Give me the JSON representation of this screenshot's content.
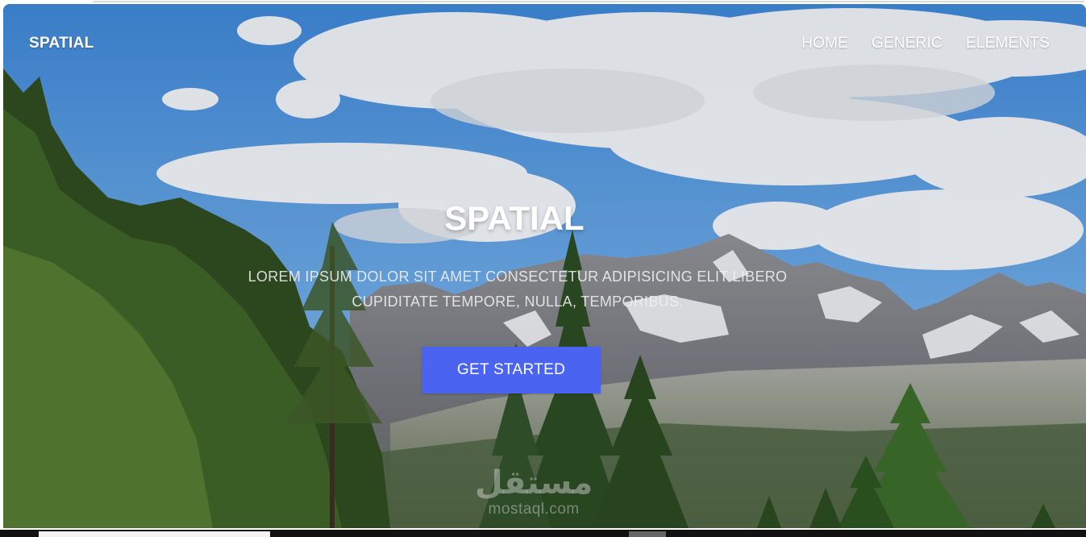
{
  "header": {
    "brand": "SPATIAL",
    "nav": [
      {
        "label": "HOME"
      },
      {
        "label": "GENERIC"
      },
      {
        "label": "ELEMENTS"
      }
    ]
  },
  "hero": {
    "title": "SPATIAL",
    "subtitle_line1": "LOREM IPSUM DOLOR SIT AMET CONSECTETUR ADIPISICING ELIT LIBERO",
    "subtitle_line2": "CUPIDITATE TEMPORE, NULLA, TEMPORIBUS.",
    "cta_label": "GET STARTED",
    "background": "mountain-forest-sky-photo"
  },
  "watermark": {
    "arabic": "مستقل",
    "latin": "mostaql.com"
  },
  "colors": {
    "accent": "#4a63f0",
    "text": "#ffffff"
  }
}
